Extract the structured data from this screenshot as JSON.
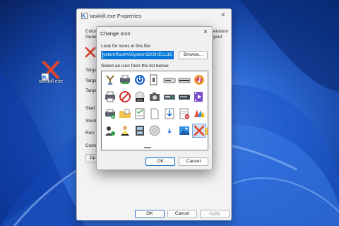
{
  "desktop": {
    "shortcut_label": "taskkill.exe"
  },
  "properties_window": {
    "title": "taskkill.exe Properties",
    "close_glyph": "×",
    "side_texts": [
      "Colou",
      "Gene",
      "Targe",
      "Targe",
      "Targe",
      "Start i",
      "Shortc",
      "Run:",
      "Comm",
      "Op"
    ],
    "right_texts": [
      "ersions",
      "yout"
    ],
    "buttons": {
      "ok": "OK",
      "cancel": "Cancel",
      "apply": "Apply"
    }
  },
  "change_icon_dialog": {
    "title": "Change Icon",
    "close_glyph": "×",
    "file_label": "Look for icons in this file:",
    "file_path": "ystemRoot%\\System32\\SHELL32.dll",
    "browse_label": "Browse...",
    "list_label": "Select an icon from the list below:",
    "ok_label": "OK",
    "cancel_label": "Cancel",
    "icons": [
      [
        "network-icon",
        "printer-network-icon",
        "power-icon",
        "device-icon",
        "drive-icon",
        "drive-bar-icon",
        "music-disc-icon"
      ],
      [
        "printer-icon",
        "no-entry-icon",
        "dvd-disc-icon",
        "camera-icon",
        "hard-drive-icon",
        "hard-drive-alt-icon",
        "video-file-icon"
      ],
      [
        "printer-check-icon",
        "folder-docs-icon",
        "checklist-icon",
        "blank-doc-icon",
        "download-icon",
        "document-x-icon",
        "colorful-app-icon"
      ],
      [
        "users-icon",
        "person-desk-icon",
        "film-icon",
        "cd-disc-icon",
        "arrow-down-icon",
        "landscape-image-icon",
        "red-x-icon",
        "folder-edge-icon"
      ]
    ]
  }
}
